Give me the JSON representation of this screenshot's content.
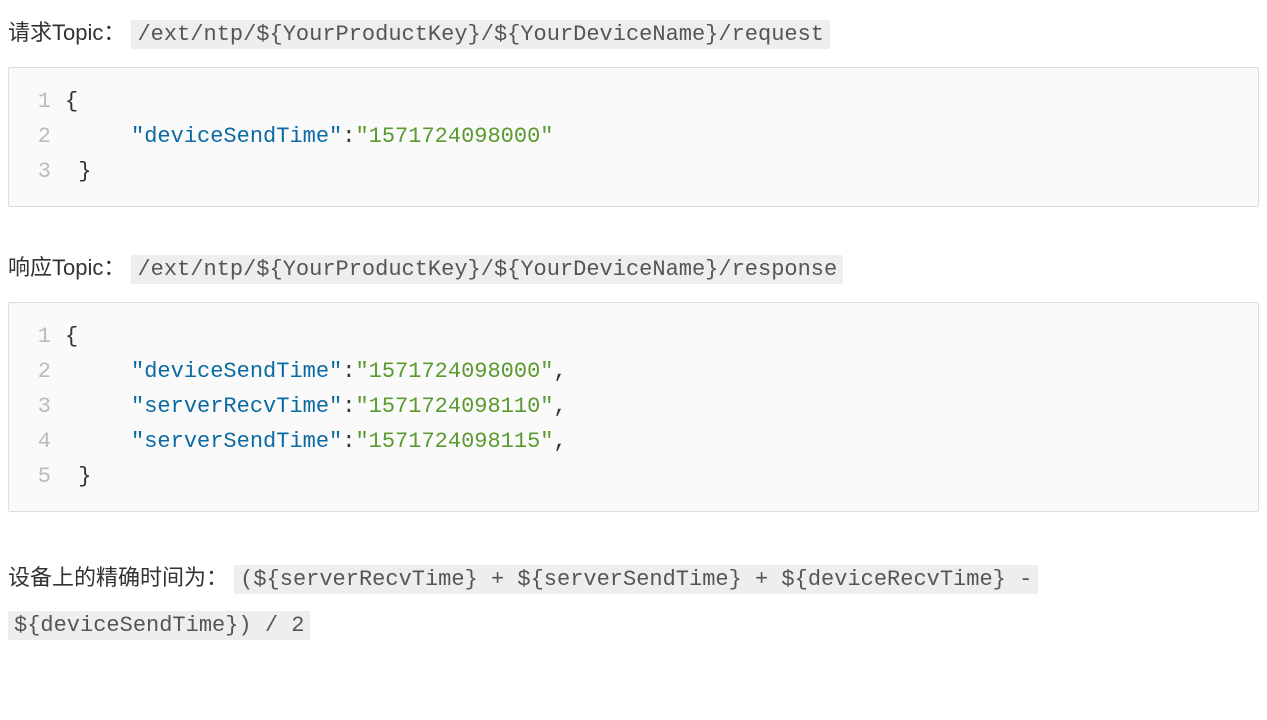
{
  "request": {
    "label": "请求Topic：",
    "topic": "/ext/ntp/${YourProductKey}/${YourDeviceName}/request",
    "code": {
      "lines": [
        {
          "n": "1",
          "tokens": [
            {
              "t": "{",
              "c": "t-plain"
            }
          ]
        },
        {
          "n": "2",
          "tokens": [
            {
              "t": "     ",
              "c": "t-plain"
            },
            {
              "t": "\"deviceSendTime\"",
              "c": "t-key"
            },
            {
              "t": ":",
              "c": "t-punc"
            },
            {
              "t": "\"1571724098000\"",
              "c": "t-str"
            }
          ]
        },
        {
          "n": "3",
          "tokens": [
            {
              "t": " }",
              "c": "t-plain"
            }
          ]
        }
      ]
    }
  },
  "response": {
    "label": "响应Topic：",
    "topic": "/ext/ntp/${YourProductKey}/${YourDeviceName}/response",
    "code": {
      "lines": [
        {
          "n": "1",
          "tokens": [
            {
              "t": "{",
              "c": "t-plain"
            }
          ]
        },
        {
          "n": "2",
          "tokens": [
            {
              "t": "     ",
              "c": "t-plain"
            },
            {
              "t": "\"deviceSendTime\"",
              "c": "t-key"
            },
            {
              "t": ":",
              "c": "t-punc"
            },
            {
              "t": "\"1571724098000\"",
              "c": "t-str"
            },
            {
              "t": ",",
              "c": "t-punc"
            }
          ]
        },
        {
          "n": "3",
          "tokens": [
            {
              "t": "     ",
              "c": "t-plain"
            },
            {
              "t": "\"serverRecvTime\"",
              "c": "t-key"
            },
            {
              "t": ":",
              "c": "t-punc"
            },
            {
              "t": "\"1571724098110\"",
              "c": "t-str"
            },
            {
              "t": ",",
              "c": "t-punc"
            }
          ]
        },
        {
          "n": "4",
          "tokens": [
            {
              "t": "     ",
              "c": "t-plain"
            },
            {
              "t": "\"serverSendTime\"",
              "c": "t-key"
            },
            {
              "t": ":",
              "c": "t-punc"
            },
            {
              "t": "\"1571724098115\"",
              "c": "t-str"
            },
            {
              "t": ",",
              "c": "t-punc"
            }
          ]
        },
        {
          "n": "5",
          "tokens": [
            {
              "t": " }",
              "c": "t-plain"
            }
          ]
        }
      ]
    }
  },
  "formula": {
    "label": "设备上的精确时间为：",
    "code_part1": "(${serverRecvTime} + ${serverSendTime} + ${deviceRecvTime} -",
    "code_part2": "${deviceSendTime}) / 2"
  }
}
